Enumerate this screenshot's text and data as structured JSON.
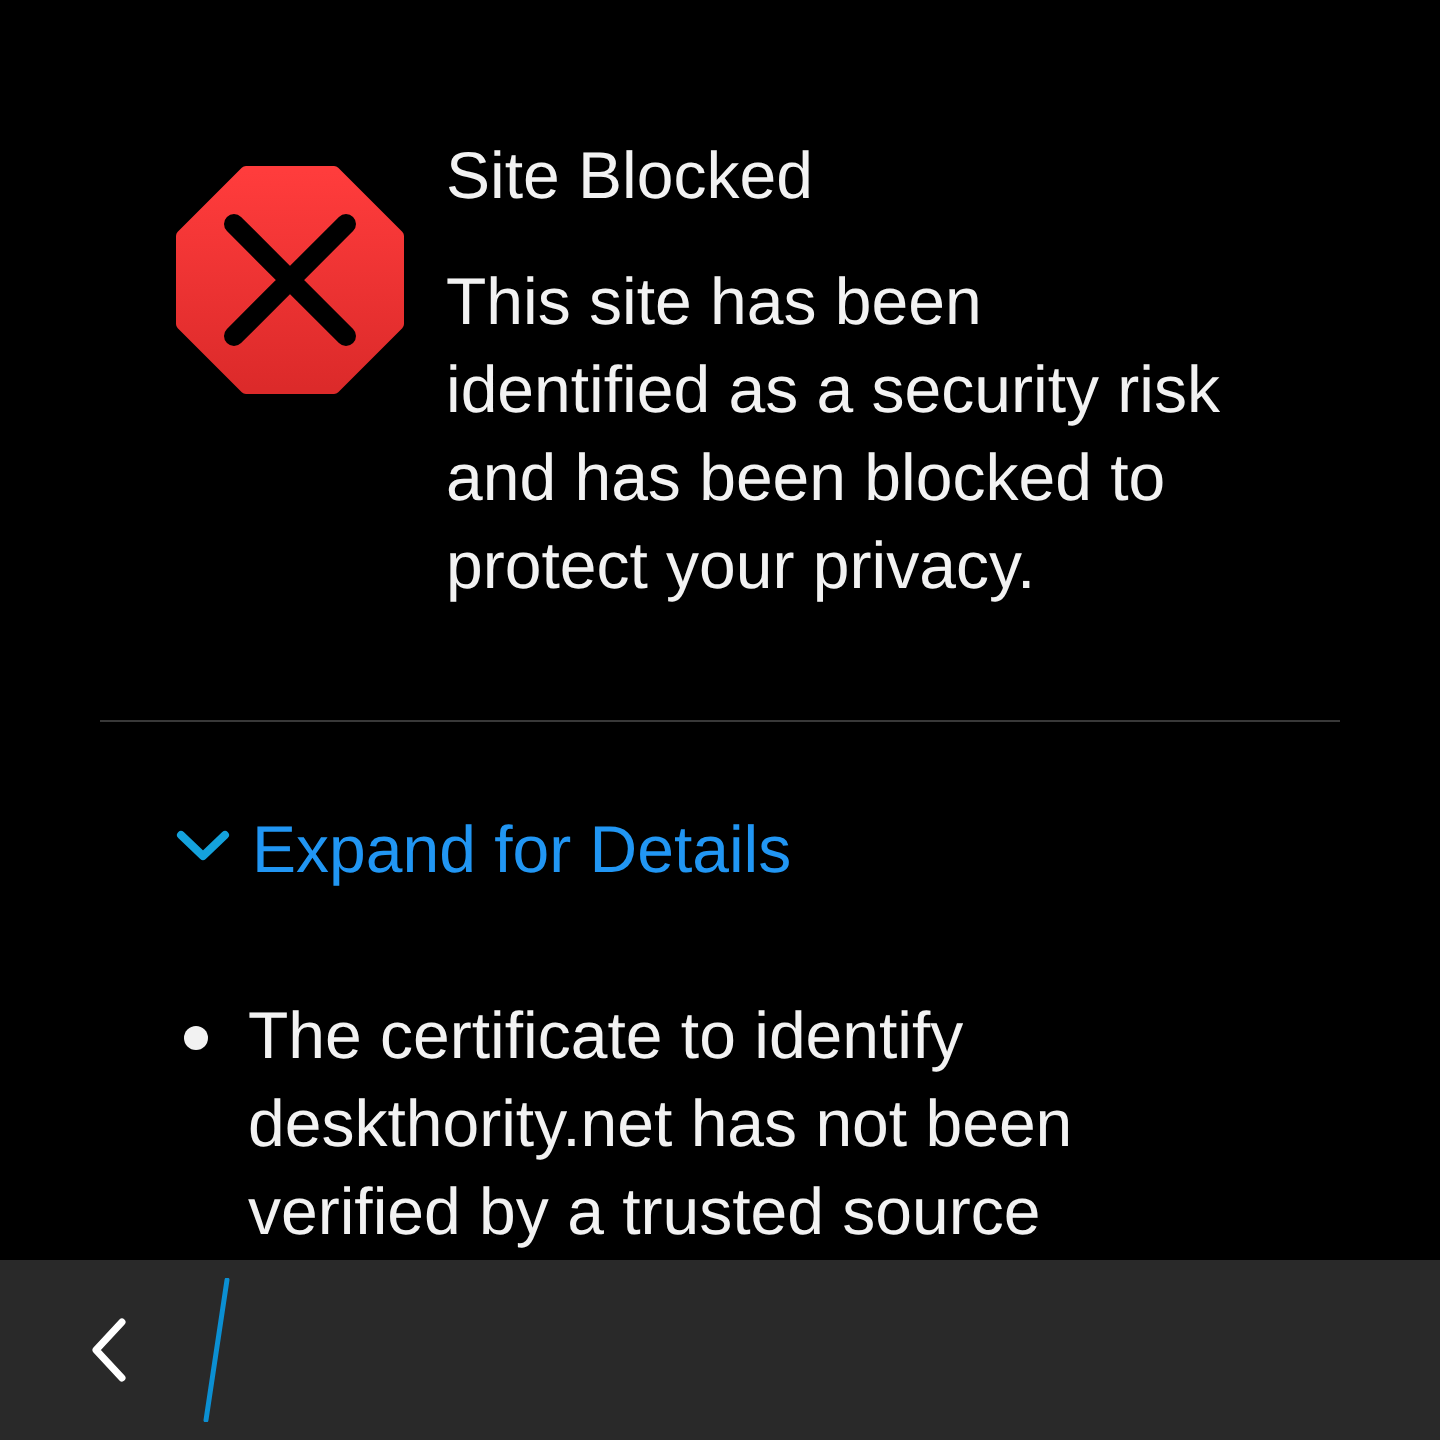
{
  "alert": {
    "title": "Site Blocked",
    "message": "This site has been identified as a security risk and has been blocked to protect your privacy."
  },
  "details_toggle": {
    "label": "Expand for Details"
  },
  "details": [
    "The certificate to identify deskthority.net has not been verified by a trusted source"
  ]
}
